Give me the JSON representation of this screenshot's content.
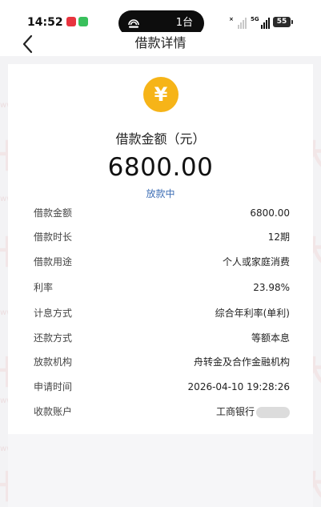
{
  "status_bar": {
    "time": "14:52",
    "island_text": "1台",
    "sim1_label": "×",
    "sim2_label": "5G",
    "battery": "55"
  },
  "nav": {
    "title": "借款详情",
    "back_icon": "chevron-left-icon"
  },
  "summary": {
    "currency_icon": "yen-icon",
    "currency_symbol": "¥",
    "amount_caption": "借款金额（元）",
    "amount": "6800.00",
    "status": "放款中"
  },
  "details": [
    {
      "label": "借款金额",
      "value": "6800.00"
    },
    {
      "label": "借款时长",
      "value": "12期"
    },
    {
      "label": "借款用途",
      "value": "个人或家庭消费"
    },
    {
      "label": "利率",
      "value": "23.98%"
    },
    {
      "label": "计息方式",
      "value": "综合年利率(单利)"
    },
    {
      "label": "还款方式",
      "value": "等额本息"
    },
    {
      "label": "放款机构",
      "value": "舟转金及合作金融机构"
    },
    {
      "label": "申请时间",
      "value": "2026-04-10 19:28:26"
    },
    {
      "label": "收款账户",
      "value": "工商银行"
    }
  ],
  "watermark": {
    "brand": "卡大侠",
    "url": "www.kadaxia.com"
  },
  "colors": {
    "coin": "#f6b418",
    "status_link": "#3f6fb5",
    "watermark": "#eb5050"
  }
}
